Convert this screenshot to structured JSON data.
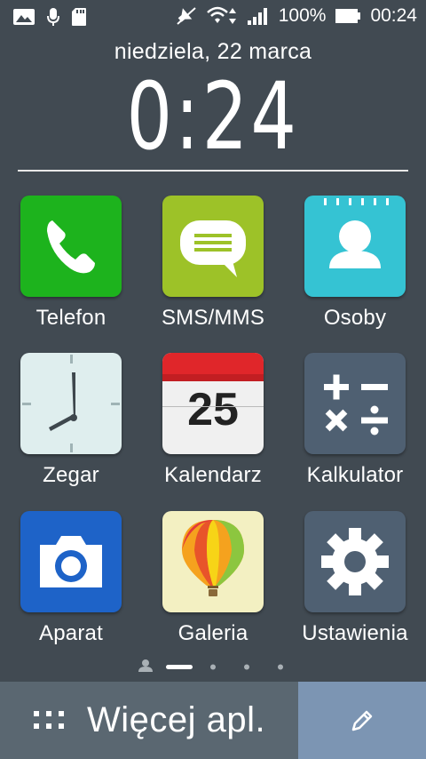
{
  "status_bar": {
    "battery_percent": "100%",
    "time": "00:24",
    "left_icons": [
      "image-icon",
      "microphone-icon",
      "sd-card-icon"
    ],
    "right_icons": [
      "mute-icon",
      "wifi-icon",
      "signal-icon",
      "battery-icon"
    ]
  },
  "lockscreen": {
    "date": "niedziela, 22 marca",
    "clock": "0:24"
  },
  "apps": [
    {
      "label": "Telefon",
      "icon": "phone-icon",
      "color": "#1db31d"
    },
    {
      "label": "SMS/MMS",
      "icon": "message-icon",
      "color": "#9dc228"
    },
    {
      "label": "Osoby",
      "icon": "contacts-icon",
      "color": "#35c3d3"
    },
    {
      "label": "Zegar",
      "icon": "clock-icon",
      "color": "#dfeeee"
    },
    {
      "label": "Kalendarz",
      "icon": "calendar-icon",
      "color": "#f0f0f0",
      "day": "25"
    },
    {
      "label": "Kalkulator",
      "icon": "calculator-icon",
      "color": "#4f6072"
    },
    {
      "label": "Aparat",
      "icon": "camera-icon",
      "color": "#1e63c8"
    },
    {
      "label": "Galeria",
      "icon": "balloon-icon",
      "color": "#f3f0c2"
    },
    {
      "label": "Ustawienia",
      "icon": "gear-icon",
      "color": "#4f6072"
    }
  ],
  "page_indicator": {
    "pages": 5,
    "current": 1
  },
  "bottom_bar": {
    "more_apps_label": "Więcej apl.",
    "edit_icon": "pencil-icon",
    "more_color": "#5a6771",
    "edit_color": "#7c95b3"
  }
}
